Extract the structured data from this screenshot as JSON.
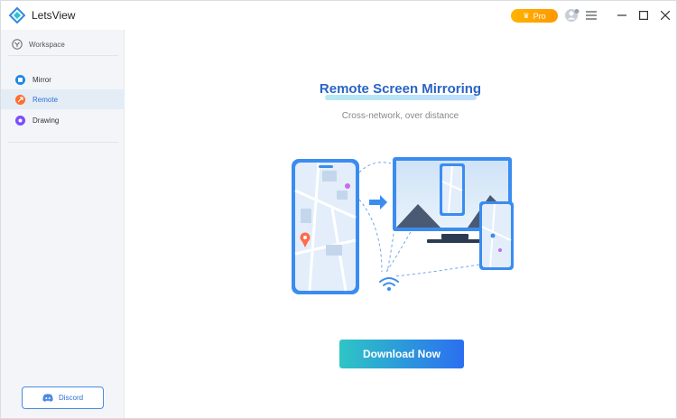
{
  "app": {
    "title": "LetsView"
  },
  "titlebar": {
    "pro_label": "Pro"
  },
  "sidebar": {
    "workspace_label": "Workspace",
    "items": [
      {
        "label": "Mirror",
        "icon": "mirror-icon",
        "color": "#1e88e5",
        "active": false
      },
      {
        "label": "Remote",
        "icon": "remote-icon",
        "color": "#ff6d2e",
        "active": true
      },
      {
        "label": "Drawing",
        "icon": "drawing-icon",
        "color": "#7c4dff",
        "active": false
      }
    ],
    "discord_label": "Discord"
  },
  "main": {
    "title": "Remote Screen Mirroring",
    "subtitle": "Cross-network, over distance",
    "download_label": "Download Now"
  },
  "colors": {
    "accent": "#2f6fd6",
    "pro": "#ff9800"
  }
}
